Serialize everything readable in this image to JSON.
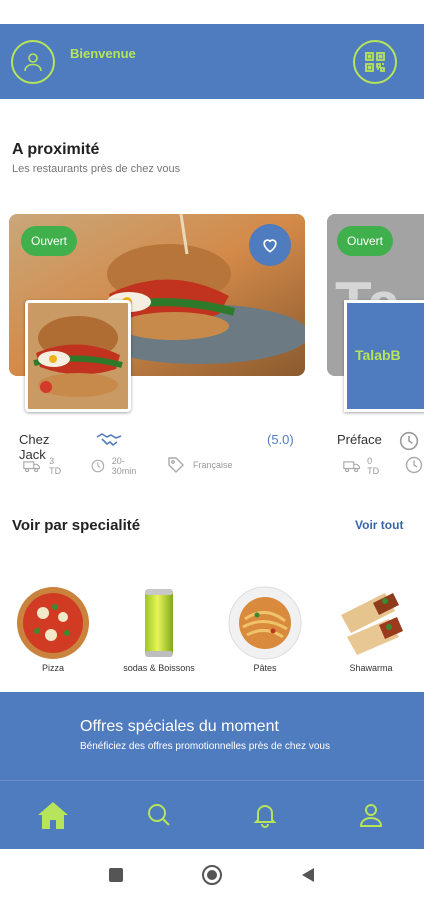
{
  "header": {
    "welcome": "Bienvenue",
    "profile_icon": "user-icon",
    "qr_icon": "qr-code-icon"
  },
  "nearby": {
    "title": "A proximité",
    "subtitle": "Les restaurants près de chez vous",
    "restaurants": [
      {
        "status": "Ouvert",
        "name": "Chez Jack",
        "rating": "(5.0)",
        "delivery_fee": "3 TD",
        "delivery_time": "20-30min",
        "cuisine": "Française"
      },
      {
        "status": "Ouvert",
        "name": "Préface",
        "delivery_fee": "0 TD",
        "logo_text": "TalabB"
      }
    ]
  },
  "specialities": {
    "title": "Voir par specialité",
    "see_all": "Voir tout",
    "items": [
      {
        "label": "Pizza"
      },
      {
        "label": "sodas & Boissons"
      },
      {
        "label": "Pâtes"
      },
      {
        "label": "Shawarma"
      }
    ]
  },
  "promo": {
    "title": "Offres spéciales du moment",
    "subtitle": "Bénéficiez des offres promotionnelles près de chez vous"
  },
  "nav": {
    "items": [
      "home-icon",
      "search-icon",
      "bell-icon",
      "user-icon"
    ]
  },
  "colors": {
    "primary": "#4f7bbf",
    "accent": "#b6e45a",
    "open_badge": "#3fb04b"
  }
}
